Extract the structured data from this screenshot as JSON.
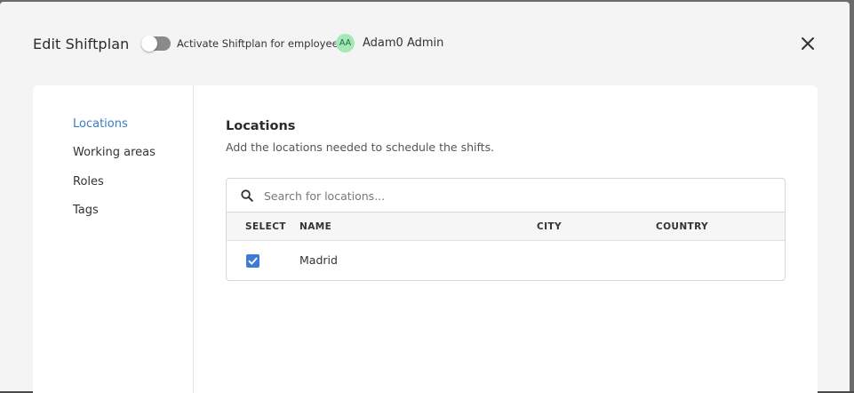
{
  "header": {
    "title": "Edit Shiftplan",
    "toggle_label": "Activate Shiftplan for employee",
    "toggle_on": false,
    "avatar_initials": "AA",
    "employee_name": "Adam0 Admin",
    "close_icon": "close-icon"
  },
  "sidebar": {
    "items": [
      {
        "label": "Locations",
        "active": true
      },
      {
        "label": "Working areas",
        "active": false
      },
      {
        "label": "Roles",
        "active": false
      },
      {
        "label": "Tags",
        "active": false
      }
    ]
  },
  "section": {
    "title": "Locations",
    "description": "Add the locations needed to schedule the shifts."
  },
  "search": {
    "placeholder": "Search for locations...",
    "value": "",
    "icon": "search-icon"
  },
  "table": {
    "columns": [
      "SELECT",
      "NAME",
      "CITY",
      "COUNTRY"
    ],
    "rows": [
      {
        "selected": true,
        "name": "Madrid",
        "city": "",
        "country": ""
      }
    ]
  },
  "colors": {
    "accent": "#3d7bc4",
    "checkbox": "#3d7bd6",
    "avatar_bg": "#a3e8b6"
  }
}
